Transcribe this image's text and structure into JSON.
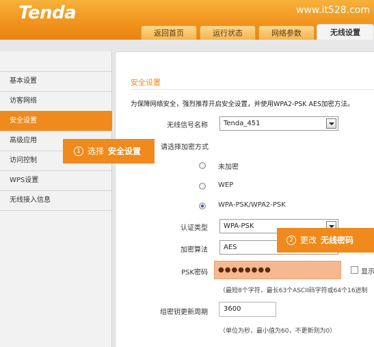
{
  "header": {
    "logo": "Tenda",
    "watermark": "www.it528.com",
    "tabs": [
      {
        "label": "返回首页",
        "active": false
      },
      {
        "label": "运行状态",
        "active": false
      },
      {
        "label": "网络参数",
        "active": false
      },
      {
        "label": "无线设置",
        "active": true
      }
    ]
  },
  "sidebar": {
    "items": [
      {
        "label": "基本设置",
        "active": false
      },
      {
        "label": "访客网络",
        "active": false
      },
      {
        "label": "安全设置",
        "active": true
      },
      {
        "label": "高级应用",
        "active": false
      },
      {
        "label": "访问控制",
        "active": false
      },
      {
        "label": "WPS设置",
        "active": false
      },
      {
        "label": "无线接入信息",
        "active": false
      }
    ]
  },
  "main": {
    "section_title": "安全设置",
    "intro": "为保障网络安全，强烈推荐开启安全设置，并使用WPA2-PSK AES加密方法。",
    "ssid_label": "无线信号名称",
    "ssid_value": "Tenda_451",
    "encryption_prompt": "请选择加密方式",
    "encryption_options": [
      {
        "label": "未加密",
        "checked": false
      },
      {
        "label": "WEP",
        "checked": false
      },
      {
        "label": "WPA-PSK/WPA2-PSK",
        "checked": true
      }
    ],
    "auth_label": "认证类型",
    "auth_value": "WPA-PSK",
    "algo_label": "加密算法",
    "algo_value": "AES",
    "psk_label": "PSK密码",
    "psk_value": "●●●●●●●●",
    "show_label": "显示",
    "psk_hint": "（最短8个字符，最长63个ASCII码字符或64个16进制",
    "rekey_label": "组密钥更新周期",
    "rekey_value": "3600",
    "rekey_hint": "（单位为秒，最小值为60，不更新则为0）"
  },
  "callouts": [
    {
      "num": "1",
      "text": "选择",
      "strong": "安全设置"
    },
    {
      "num": "2",
      "text": "更改",
      "strong": "无线密码"
    }
  ],
  "colors": {
    "accent": "#f08a1c",
    "header": "#f0931d",
    "password_highlight": "#f6b98f"
  }
}
